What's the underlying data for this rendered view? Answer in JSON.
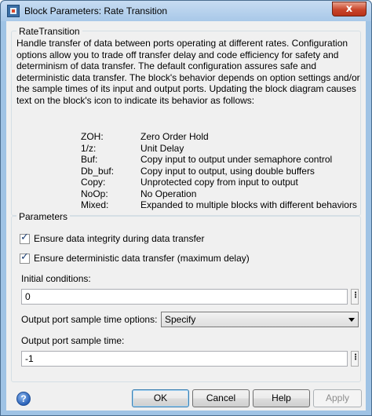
{
  "window": {
    "title": "Block Parameters: Rate Transition",
    "close_glyph": "x"
  },
  "description": {
    "group_title": "RateTransition",
    "text": "Handle transfer of data between ports operating at different rates. Configuration options allow you to trade off transfer delay and code efficiency for safety and determinism of data transfer. The default configuration assures safe and deterministic data transfer. The block's behavior depends on option settings and/or the sample times of its input and output ports. Updating the block diagram causes text on the block's icon to indicate its behavior as follows:",
    "options": [
      {
        "key": "ZOH:",
        "value": "Zero Order Hold"
      },
      {
        "key": "1/z:",
        "value": "Unit Delay"
      },
      {
        "key": "Buf:",
        "value": "Copy input to output under semaphore control"
      },
      {
        "key": "Db_buf:",
        "value": "Copy input to output, using double buffers"
      },
      {
        "key": "Copy:",
        "value": "Unprotected copy from input to output"
      },
      {
        "key": "NoOp:",
        "value": "No Operation"
      },
      {
        "key": "Mixed:",
        "value": "Expanded to multiple blocks with different behaviors"
      }
    ]
  },
  "parameters": {
    "group_title": "Parameters",
    "integrity_checkbox": {
      "label": "Ensure data integrity during data transfer",
      "checked": true
    },
    "deterministic_checkbox": {
      "label": "Ensure deterministic data transfer (maximum delay)",
      "checked": true
    },
    "initial_conditions": {
      "label": "Initial conditions:",
      "value": "0"
    },
    "sample_time_options": {
      "label": "Output port sample time options:",
      "selected": "Specify"
    },
    "sample_time": {
      "label": "Output port sample time:",
      "value": "-1"
    },
    "ellipsis_glyph": "⋮",
    "check_glyph": "✓"
  },
  "buttons": {
    "help_glyph": "?",
    "ok": "OK",
    "cancel": "Cancel",
    "help": "Help",
    "apply": "Apply"
  }
}
